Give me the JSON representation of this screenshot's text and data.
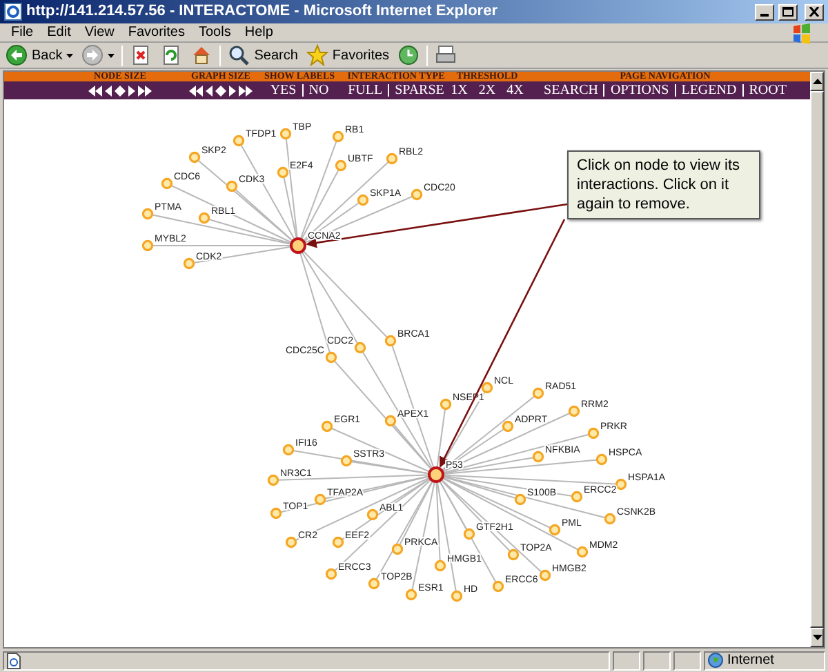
{
  "window": {
    "title": "http://141.214.57.56 - INTERACTOME - Microsoft Internet Explorer"
  },
  "menu": [
    "File",
    "Edit",
    "View",
    "Favorites",
    "Tools",
    "Help"
  ],
  "toolbar": [
    {
      "kind": "back",
      "label": "Back"
    },
    {
      "kind": "forward"
    },
    {
      "kind": "stop"
    },
    {
      "kind": "refresh"
    },
    {
      "kind": "home"
    },
    {
      "kind": "search",
      "label": "Search"
    },
    {
      "kind": "favorites",
      "label": "Favorites"
    },
    {
      "kind": "history"
    },
    {
      "kind": "print"
    }
  ],
  "nav_sections": [
    {
      "heading": "NODE SIZE",
      "kind": "arrows"
    },
    {
      "heading": "GRAPH SIZE",
      "kind": "arrows"
    },
    {
      "heading": "SHOW LABELS",
      "kind": "links",
      "links": [
        "YES",
        "NO"
      ]
    },
    {
      "heading": "INTERACTION TYPE",
      "kind": "links",
      "links": [
        "FULL",
        "SPARSE"
      ]
    },
    {
      "heading": "THRESHOLD",
      "kind": "links",
      "links": [
        "1X",
        "2X",
        "4X"
      ]
    },
    {
      "heading": "PAGE NAVIGATION",
      "kind": "links",
      "links": [
        "SEARCH",
        "OPTIONS",
        "LEGEND",
        "ROOT"
      ]
    }
  ],
  "graph": {
    "hubs": [
      {
        "label": "CCNA2",
        "selected": true,
        "neighbors": [
          "TBP",
          "RB1",
          "TFDP1",
          "SKP2",
          "RBL2",
          "UBTF",
          "E2F4",
          "CDC6",
          "CDK3",
          "CDC20",
          "SKP1A",
          "PTMA",
          "RBL1",
          "MYBL2",
          "CDK2"
        ]
      },
      {
        "label": "P53",
        "selected": true,
        "neighbors": [
          "NCL",
          "RAD51",
          "NSEP1",
          "RRM2",
          "APEX1",
          "ADPRT",
          "EGR1",
          "PRKR",
          "IFI16",
          "SSTR3",
          "NFKBIA",
          "HSPCA",
          "NR3C1",
          "HSPA1A",
          "TFAP2A",
          "S100B",
          "ERCC2",
          "TOP1",
          "ABL1",
          "CSNK2B",
          "PML",
          "GTF2H1",
          "CR2",
          "EEF2",
          "PRKCA",
          "MDM2",
          "TOP2A",
          "HMGB1",
          "ERCC3",
          "HMGB2",
          "TOP2B",
          "ERCC6",
          "ESR1",
          "HD"
        ]
      }
    ],
    "shared": [
      "BRCA1",
      "CDC2",
      "CDC25C"
    ]
  },
  "callout": "Click on node to view its interactions. Click on it again to remove.",
  "status_bar": {
    "zone": "Internet"
  }
}
